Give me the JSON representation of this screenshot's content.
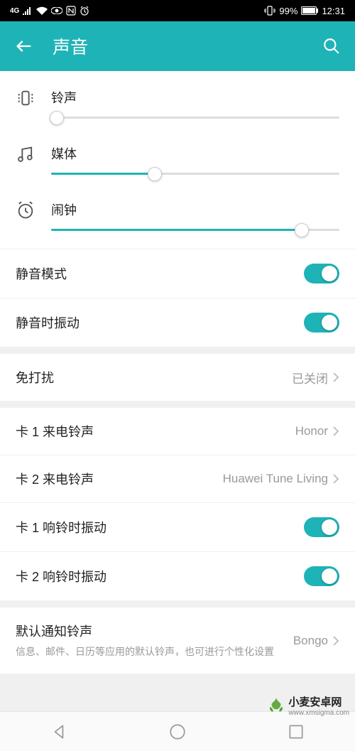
{
  "status_bar": {
    "network_icon": "4G",
    "battery_pct": "99%",
    "time": "12:31"
  },
  "header": {
    "title": "声音"
  },
  "sliders": {
    "ringtone": {
      "label": "铃声",
      "value": 2
    },
    "media": {
      "label": "媒体",
      "value": 36
    },
    "alarm": {
      "label": "闹钟",
      "value": 87
    }
  },
  "toggles": {
    "silent_mode": {
      "label": "静音模式",
      "on": true
    },
    "vibrate_silent": {
      "label": "静音时振动",
      "on": true
    },
    "sim1_ring_vibrate": {
      "label": "卡 1 响铃时振动",
      "on": true
    },
    "sim2_ring_vibrate": {
      "label": "卡 2 响铃时振动",
      "on": true
    }
  },
  "links": {
    "dnd": {
      "label": "免打扰",
      "value": "已关闭"
    },
    "sim1_ringtone": {
      "label": "卡 1 来电铃声",
      "value": "Honor"
    },
    "sim2_ringtone": {
      "label": "卡 2 来电铃声",
      "value": "Huawei Tune Living"
    },
    "default_notification": {
      "label": "默认通知铃声",
      "sub": "信息、邮件、日历等应用的默认铃声，也可进行个性化设置",
      "value": "Bongo"
    }
  },
  "watermark": {
    "brand": "小麦安卓网",
    "url": "www.xmsigma.com"
  }
}
